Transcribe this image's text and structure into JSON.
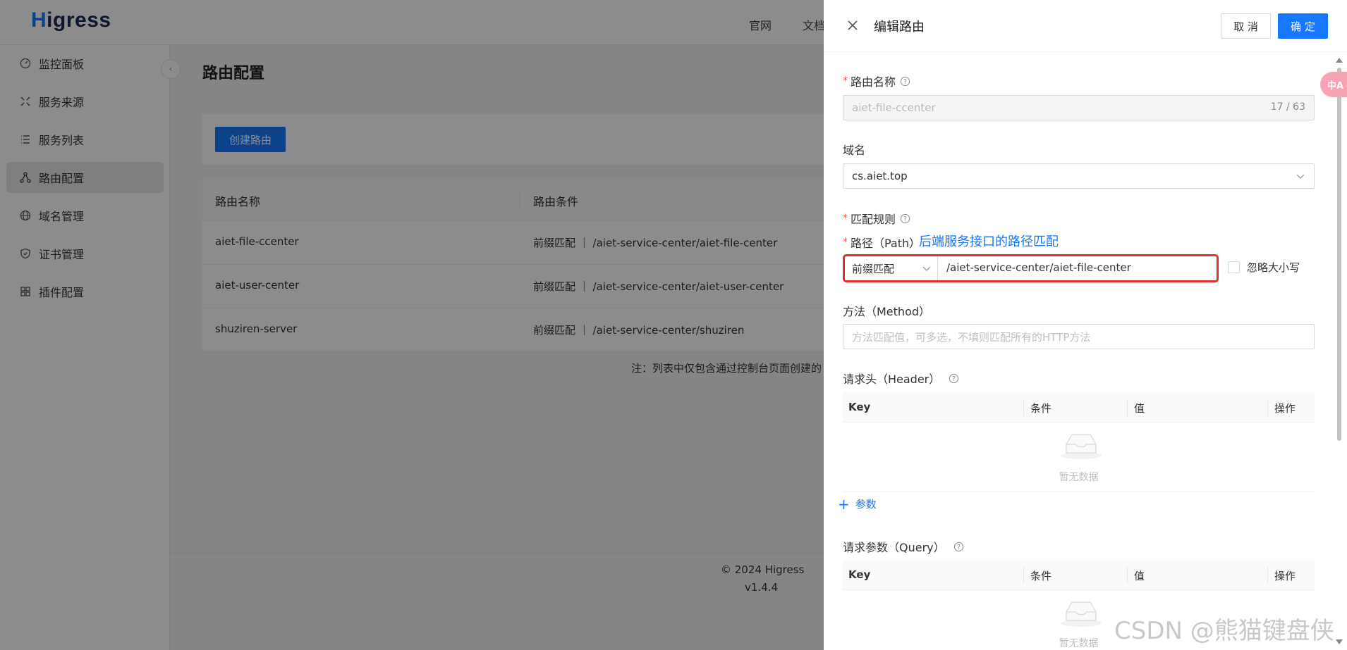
{
  "app": {
    "logo_h": "H",
    "logo_rest": "igress"
  },
  "header": {
    "links": [
      "官网",
      "文档"
    ]
  },
  "sidebar": {
    "items": [
      {
        "label": "监控面板",
        "icon": "dashboard-icon"
      },
      {
        "label": "服务来源",
        "icon": "service-source-icon"
      },
      {
        "label": "服务列表",
        "icon": "list-icon"
      },
      {
        "label": "路由配置",
        "icon": "route-icon",
        "active": true
      },
      {
        "label": "域名管理",
        "icon": "globe-icon"
      },
      {
        "label": "证书管理",
        "icon": "shield-icon"
      },
      {
        "label": "插件配置",
        "icon": "plugin-icon"
      }
    ],
    "collapse": "‹"
  },
  "page": {
    "title": "路由配置",
    "create_button": "创建路由",
    "table": {
      "columns": [
        "路由名称",
        "路由条件"
      ],
      "rows": [
        {
          "name": "aiet-file-ccenter",
          "condition": "前缀匹配 ｜ /aiet-service-center/aiet-file-center"
        },
        {
          "name": "aiet-user-center",
          "condition": "前缀匹配 ｜ /aiet-service-center/aiet-user-center"
        },
        {
          "name": "shuziren-server",
          "condition": "前缀匹配 ｜ /aiet-service-center/shuziren"
        }
      ]
    },
    "note": "注：列表中仅包含通过控制台页面创建的"
  },
  "footer": {
    "copyright": "© 2024 Higress",
    "version": "v1.4.4"
  },
  "drawer": {
    "title": "编辑路由",
    "cancel": "取 消",
    "ok": "确 定",
    "route_name": {
      "label": "路由名称",
      "value": "aiet-file-ccenter",
      "count": "17 / 63"
    },
    "domain": {
      "label": "域名",
      "value": "cs.aiet.top"
    },
    "match_rules": {
      "label": "匹配规则"
    },
    "path": {
      "label": "路径（Path）",
      "hint": "后端服务接口的路径匹配",
      "match_type": "前缀匹配",
      "value": "/aiet-service-center/aiet-file-center",
      "ignore_case": "忽略大小写"
    },
    "method": {
      "label": "方法（Method）",
      "placeholder": "方法匹配值，可多选，不填则匹配所有的HTTP方法"
    },
    "header": {
      "label": "请求头（Header）",
      "columns": [
        "Key",
        "条件",
        "值",
        "操作"
      ],
      "empty": "暂无数据",
      "add": "参数"
    },
    "query": {
      "label": "请求参数（Query）",
      "columns": [
        "Key",
        "条件",
        "值",
        "操作"
      ],
      "empty": "暂无数据"
    }
  },
  "translate_badge": "中A",
  "watermark": "CSDN @熊猫键盘侠",
  "colors": {
    "primary": "#1677ff",
    "highlight_border": "#e02f2f",
    "required": "#ff4d4f"
  }
}
